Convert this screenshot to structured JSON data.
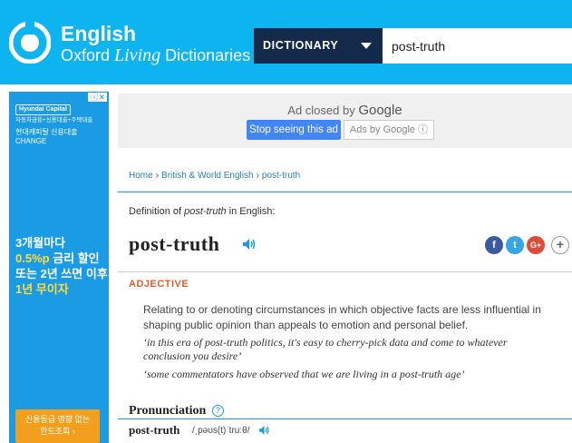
{
  "header": {
    "brand_line1": "English",
    "brand_line2_a": "Oxford ",
    "brand_line2_b": "Living",
    "brand_line2_c": " Dictionaries",
    "dict_select": "DICTIONARY",
    "search_value": "post-truth",
    "bg_color": "#0eb4f0",
    "select_color": "#142a4b"
  },
  "left_ad": {
    "chip": "ⓘ✕",
    "brand": "Hyundai Capital",
    "small": "자동차금융+신용대출+주택대출",
    "mid1": "현대캐피탈 신용대출",
    "mid2": "CHANGE",
    "big1": "3개월마다",
    "big2_y": "0.5%p",
    "big2": " 금리 할인",
    "big3": "또는 2년 쓰면 이후",
    "big4_y": "1년 무이자",
    "btn1": "신용등급 영향 없는",
    "btn2": "한도조회 ›"
  },
  "ad_closed": {
    "text": "Ad closed by ",
    "google": "Google",
    "stop": "Stop seeing this ad",
    "why": "Ads by Google ⓘ"
  },
  "breadcrumb": {
    "items": [
      "Home",
      "British & World English",
      "post-truth"
    ],
    "sep": "›"
  },
  "definition": {
    "def_of_pre": "Definition of ",
    "def_of_word": "post-truth",
    "def_of_post": " in English:",
    "headword": "post-truth",
    "pos": "ADJECTIVE",
    "sense": "Relating to or denoting circumstances in which objective facts are less influential in shaping public opinion than appeals to emotion and personal belief.",
    "example1": "‘in this era of post-truth politics, it's easy to cherry-pick data and come to whatever conclusion you desire’",
    "example2": "‘some commentators have observed that we are living in a post-truth age’"
  },
  "share": {
    "fb": "f",
    "tw": "t",
    "gp": "G+",
    "more": "+"
  },
  "pronunciation": {
    "title": "Pronunciation",
    "help": "?",
    "word": "post-truth",
    "ipa": "/ˌpəʊs(t)ˈtruːθ/"
  }
}
